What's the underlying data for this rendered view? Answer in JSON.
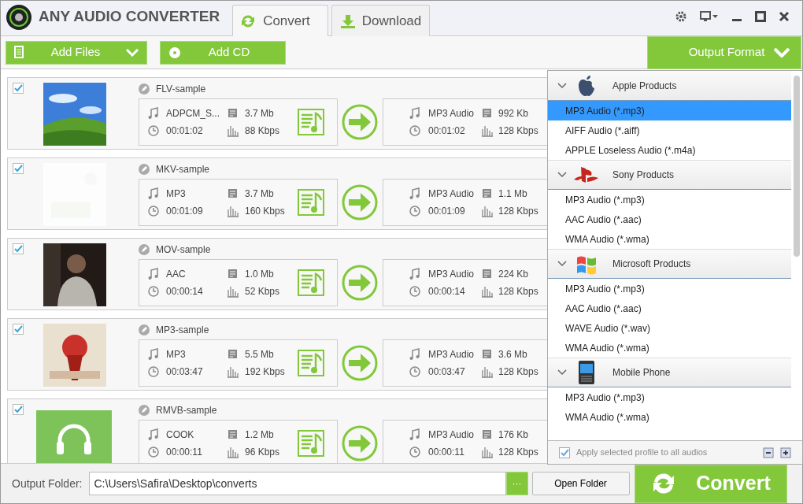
{
  "app": {
    "title": "ANY AUDIO CONVERTER"
  },
  "tabs": [
    {
      "label": "Convert",
      "kind": "convert",
      "selected": true
    },
    {
      "label": "Download",
      "kind": "download",
      "selected": false
    }
  ],
  "toolbar": {
    "add_files": "Add Files",
    "add_cd": "Add CD",
    "output_format": "Output Format"
  },
  "files": [
    {
      "name": "FLV-sample",
      "checked": true,
      "kind": "picture",
      "source": {
        "codec": "ADPCM_S...",
        "size": "3.7 Mb",
        "duration": "00:01:02",
        "bitrate": "88 Kbps"
      },
      "target": {
        "format": "MP3 Audio",
        "size": "992 Kb",
        "duration": "00:01:02",
        "bitrate": "128 Kbps"
      }
    },
    {
      "name": "MKV-sample",
      "checked": true,
      "kind": "picture",
      "source": {
        "codec": "MP3",
        "size": "3.7 Mb",
        "duration": "00:01:09",
        "bitrate": "160 Kbps"
      },
      "target": {
        "format": "MP3 Audio",
        "size": "1.1 Mb",
        "duration": "00:01:09",
        "bitrate": "128 Kbps"
      }
    },
    {
      "name": "MOV-sample",
      "checked": true,
      "kind": "picture",
      "source": {
        "codec": "AAC",
        "size": "1.0 Mb",
        "duration": "00:00:14",
        "bitrate": "52 Kbps"
      },
      "target": {
        "format": "MP3 Audio",
        "size": "224 Kb",
        "duration": "00:00:14",
        "bitrate": "128 Kbps"
      }
    },
    {
      "name": "MP3-sample",
      "checked": true,
      "kind": "picture",
      "source": {
        "codec": "MP3",
        "size": "5.5 Mb",
        "duration": "00:03:47",
        "bitrate": "192 Kbps"
      },
      "target": {
        "format": "MP3 Audio",
        "size": "3.6 Mb",
        "duration": "00:03:47",
        "bitrate": "128 Kbps"
      }
    },
    {
      "name": "RMVB-sample",
      "checked": true,
      "kind": "audio",
      "source": {
        "codec": "COOK",
        "size": "1.2 Mb",
        "duration": "00:00:11",
        "bitrate": "96 Kbps"
      },
      "target": {
        "format": "MP3 Audio",
        "size": "176 Kb",
        "duration": "00:00:11",
        "bitrate": "128 Kbps"
      }
    }
  ],
  "format_panel": {
    "groups": [
      {
        "name": "Apple Products",
        "kind": "apple",
        "expanded": true,
        "items": [
          {
            "label": "MP3 Audio (*.mp3)",
            "selected": true
          },
          {
            "label": "AIFF Audio (*.aiff)",
            "selected": false
          },
          {
            "label": "APPLE Loseless Audio (*.m4a)",
            "selected": false
          }
        ]
      },
      {
        "name": "Sony Products",
        "kind": "sony",
        "expanded": true,
        "items": [
          {
            "label": "MP3 Audio (*.mp3)",
            "selected": false
          },
          {
            "label": "AAC Audio (*.aac)",
            "selected": false
          },
          {
            "label": "WMA Audio (*.wma)",
            "selected": false
          }
        ]
      },
      {
        "name": "Microsoft Products",
        "kind": "windows",
        "expanded": true,
        "items": [
          {
            "label": "MP3 Audio (*.mp3)",
            "selected": false
          },
          {
            "label": "AAC Audio (*.aac)",
            "selected": false
          },
          {
            "label": "WAVE Audio (*.wav)",
            "selected": false
          },
          {
            "label": "WMA Audio (*.wma)",
            "selected": false
          }
        ]
      },
      {
        "name": "Mobile Phone",
        "kind": "phone",
        "expanded": true,
        "items": [
          {
            "label": "MP3 Audio (*.mp3)",
            "selected": false
          },
          {
            "label": "WMA Audio (*.wma)",
            "selected": false
          }
        ]
      }
    ],
    "apply_all": {
      "label": "Apply selected profile to all audios",
      "checked": true
    }
  },
  "output": {
    "label": "Output Folder:",
    "value": "C:\\Users\\Safira\\Desktop\\converts",
    "browse": "···",
    "open_folder": "Open Folder"
  },
  "convert_button": "Convert"
}
